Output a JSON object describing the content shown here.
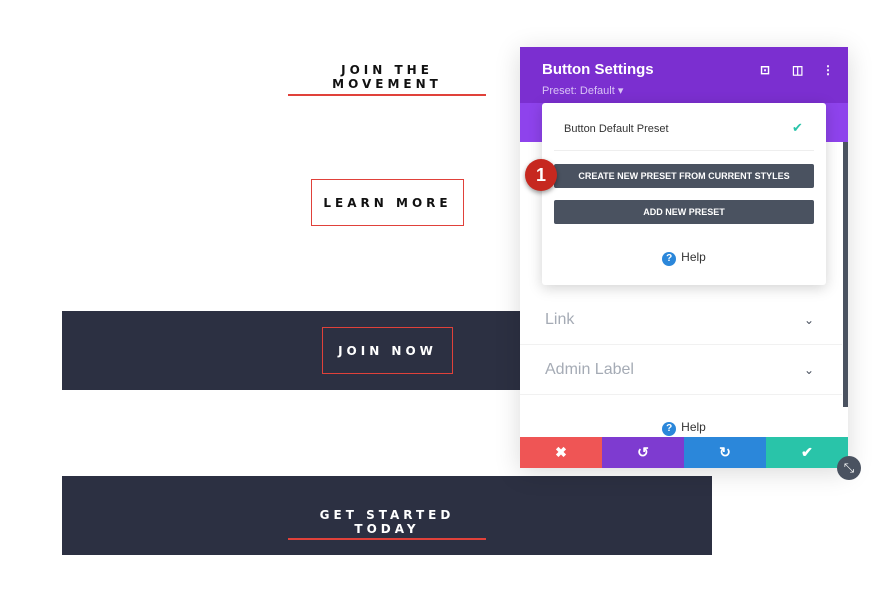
{
  "page": {
    "heading1": "JOIN THE MOVEMENT",
    "learn_more": "LEARN MORE",
    "join_now": "JOIN NOW",
    "heading2": "GET STARTED TODAY"
  },
  "panel": {
    "title": "Button Settings",
    "preset": "Preset: Default ▾",
    "icons": [
      "fullscreen-icon",
      "split-view-icon",
      "more-icon"
    ],
    "dropdown": {
      "current": "Button Default Preset",
      "step": "1",
      "create": "CREATE NEW PRESET FROM CURRENT STYLES",
      "add": "ADD NEW PRESET",
      "help": "Help"
    },
    "sections": [
      "Link",
      "Admin Label"
    ],
    "help": "Help"
  },
  "colors": {
    "purple": "#7b2fd0",
    "cancel": "#ef5555",
    "undo": "#7e3bd0",
    "redo": "#2b87da",
    "save": "#29c4a9",
    "accent": "#e0413a",
    "dark": "#2c3042"
  }
}
